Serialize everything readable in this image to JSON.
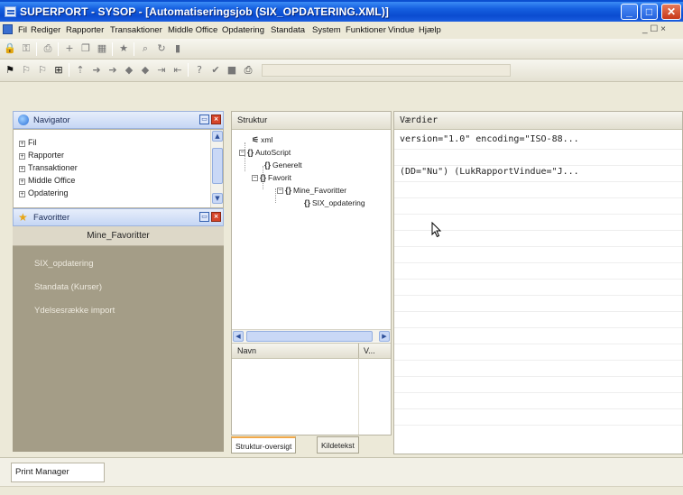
{
  "window": {
    "title": "SUPERPORT - SYSOP - [Automatiseringsjob (SIX_OPDATERING.XML)]",
    "controls": {
      "minimize": "_",
      "maximize": "□",
      "close": "✕"
    }
  },
  "menubar": {
    "items": [
      "Fil",
      "Rediger",
      "Rapporter",
      "Transaktioner",
      "Middle Office",
      "Opdatering",
      "Standata",
      "System",
      "Funktioner",
      "Vindue",
      "Hjælp"
    ],
    "mdi_controls": "_ ☐ ×"
  },
  "navigator": {
    "title": "Navigator",
    "items": [
      "Fil",
      "Rapporter",
      "Transaktioner",
      "Middle Office",
      "Opdatering"
    ]
  },
  "favorites": {
    "title": "Favoritter",
    "group": "Mine_Favoritter",
    "items": [
      "SIX_opdatering",
      "Standata (Kurser)",
      "Ydelsesrække import"
    ]
  },
  "structure": {
    "title": "Struktur",
    "tree": {
      "xml": "xml",
      "autoscript": "AutoScript",
      "generelt": "Generelt",
      "favorit": "Favorit",
      "mine_favoritter": "Mine_Favoritter",
      "six_opdatering": "SIX_opdatering"
    },
    "list_columns": [
      "Navn",
      "V..."
    ],
    "tabs": [
      "Struktur-oversigt",
      "Kildetekst"
    ]
  },
  "values": {
    "title": "Værdier",
    "lines": [
      "version=\"1.0\" encoding=\"ISO-88...",
      "(DD=\"Nu\") (LukRapportVindue=\"J..."
    ]
  },
  "status": {
    "print_manager": "Print Manager"
  },
  "colors": {
    "titlebar": "#1660e0",
    "favorites_bg": "#a49d87",
    "chrome": "#ece9d8"
  }
}
